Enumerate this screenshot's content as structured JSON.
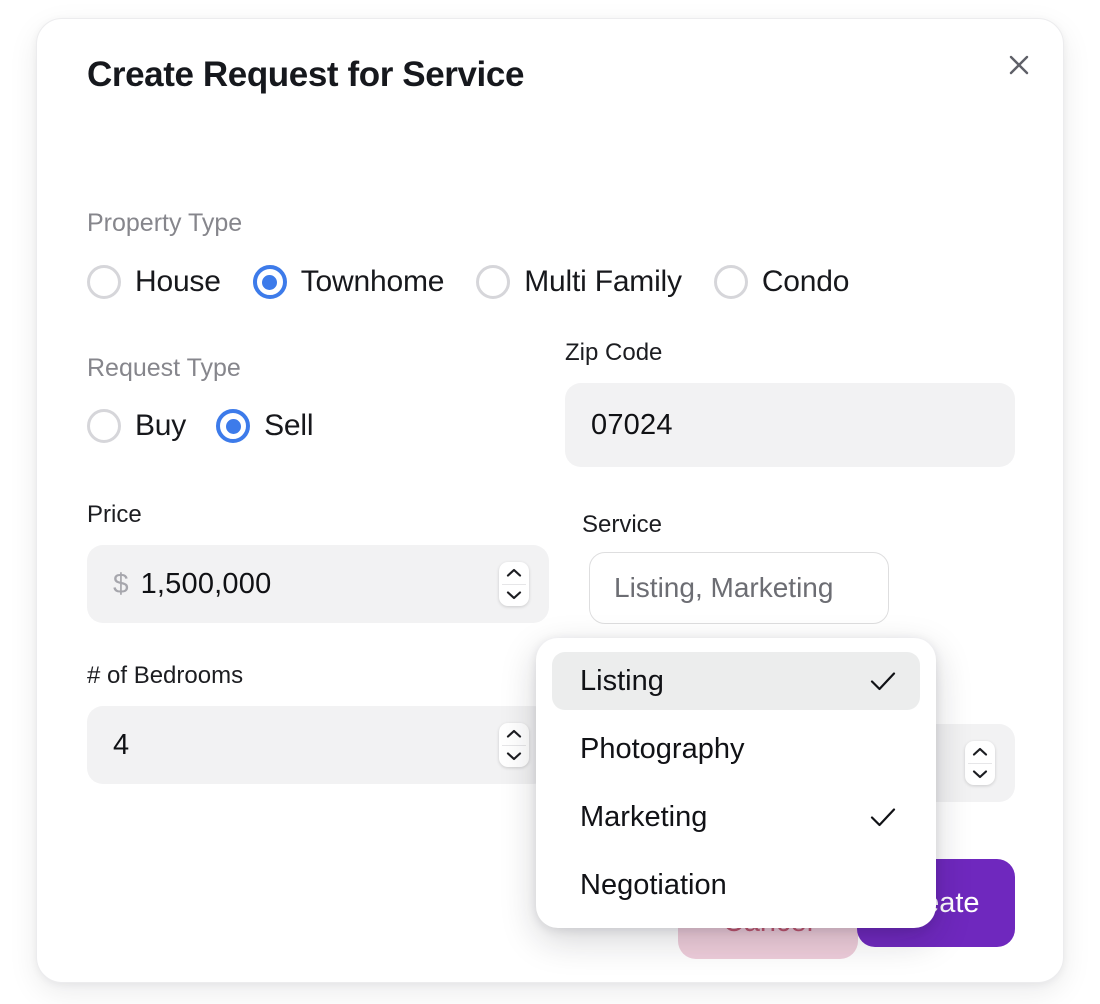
{
  "modal": {
    "title": "Create Request for Service",
    "close_icon": "close-icon"
  },
  "property_type": {
    "label": "Property Type",
    "options": [
      {
        "label": "House",
        "selected": false
      },
      {
        "label": "Townhome",
        "selected": true
      },
      {
        "label": "Multi Family",
        "selected": false
      },
      {
        "label": "Condo",
        "selected": false
      }
    ]
  },
  "request_type": {
    "label": "Request Type",
    "options": [
      {
        "label": "Buy",
        "selected": false
      },
      {
        "label": "Sell",
        "selected": true
      }
    ]
  },
  "zip_code": {
    "label": "Zip Code",
    "value": "07024"
  },
  "price": {
    "label": "Price",
    "prefix": "$",
    "value": "1,500,000"
  },
  "service": {
    "label": "Service",
    "value": "Listing, Marketing",
    "options": [
      {
        "label": "Listing",
        "checked": true,
        "highlighted": true
      },
      {
        "label": "Photography",
        "checked": false,
        "highlighted": false
      },
      {
        "label": "Marketing",
        "checked": true,
        "highlighted": false
      },
      {
        "label": "Negotiation",
        "checked": false,
        "highlighted": false
      }
    ]
  },
  "bedrooms": {
    "label": "# of Bedrooms",
    "value": "4"
  },
  "secondary_number": {
    "value": ""
  },
  "footer": {
    "cancel_label": "Cancel",
    "create_label": "Create"
  },
  "colors": {
    "accent_blue": "#3d7bea",
    "primary_purple": "#6f28be",
    "cancel_pink": "#eecdda",
    "input_bg": "#f2f2f3",
    "muted_text": "#86868c"
  }
}
